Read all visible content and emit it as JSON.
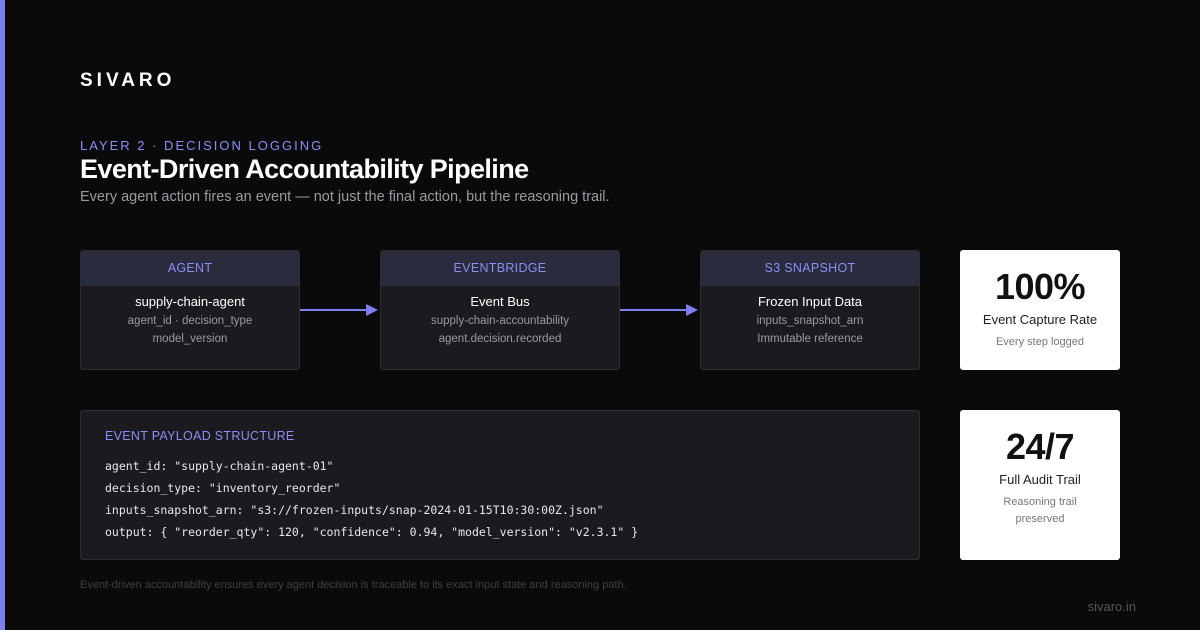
{
  "brand": "SIVARO",
  "eyebrow": "LAYER 2 · DECISION LOGGING",
  "title": "Event-Driven Accountability Pipeline",
  "subtitle": "Every agent action fires an event — not just the final action, but the reasoning trail.",
  "nodes": [
    {
      "header": "AGENT",
      "main": "supply-chain-agent",
      "line1": "agent_id · decision_type",
      "line2": "model_version"
    },
    {
      "header": "EVENTBRIDGE",
      "main": "Event Bus",
      "line1": "supply-chain-accountability",
      "line2": "agent.decision.recorded"
    },
    {
      "header": "S3 SNAPSHOT",
      "main": "Frozen Input Data",
      "line1": "inputs_snapshot_arn",
      "line2": "Immutable reference"
    }
  ],
  "stats": [
    {
      "value": "100%",
      "label": "Event Capture Rate",
      "note": "Every step logged"
    },
    {
      "value": "24/7",
      "label": "Full Audit Trail",
      "note": "Reasoning trail preserved"
    }
  ],
  "payload": {
    "title": "EVENT PAYLOAD STRUCTURE",
    "lines": [
      "agent_id: \"supply-chain-agent-01\"",
      "decision_type: \"inventory_reorder\"",
      "inputs_snapshot_arn: \"s3://frozen-inputs/snap-2024-01-15T10:30:00Z.json\"",
      "output: { \"reorder_qty\": 120, \"confidence\": 0.94, \"model_version\": \"v2.3.1\" }"
    ]
  },
  "footnote": "Event-driven accountability ensures every agent decision is traceable to its exact input state and reasoning path.",
  "site": "sivaro.in",
  "colors": {
    "accent": "#7b7ff0",
    "accent_text": "#8a8ef5",
    "background": "#0a0a0a",
    "card": "#1b1b1f",
    "card_header": "#2b2b3e"
  }
}
